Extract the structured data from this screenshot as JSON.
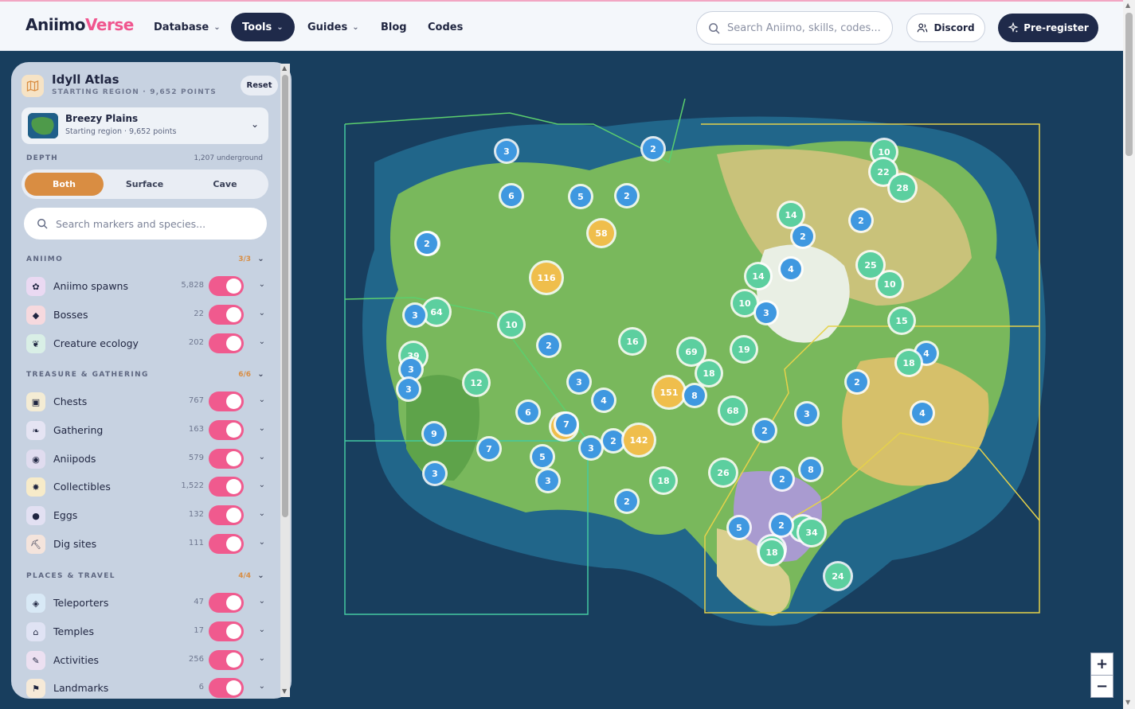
{
  "header": {
    "logo_part1": "Aniimo",
    "logo_part2": "Verse",
    "nav": [
      {
        "label": "Database",
        "has_menu": true
      },
      {
        "label": "Tools",
        "has_menu": true,
        "active": true
      },
      {
        "label": "Guides",
        "has_menu": true
      },
      {
        "label": "Blog",
        "has_menu": false
      },
      {
        "label": "Codes",
        "has_menu": false
      }
    ],
    "search_placeholder": "Search Aniimo, skills, codes...",
    "discord_label": "Discord",
    "preregister_label": "Pre-register"
  },
  "panel": {
    "title": "Idyll Atlas",
    "subtitle": "STARTING REGION · 9,652 POINTS",
    "reset_label": "Reset",
    "region": {
      "name": "Breezy Plains",
      "sub": "Starting region · 9,652 points"
    },
    "depth_label": "DEPTH",
    "depth_count": "1,207 underground",
    "depth_options": [
      "Both",
      "Surface",
      "Cave"
    ],
    "depth_selected": "Both",
    "search_placeholder": "Search markers and species...",
    "sections": [
      {
        "title": "ANIIMO",
        "count": "3/3",
        "items": [
          {
            "label": "Aniimo spawns",
            "count": "5,828",
            "icon": "aniimo-icon",
            "on": true
          },
          {
            "label": "Bosses",
            "count": "22",
            "icon": "boss-icon",
            "on": true
          },
          {
            "label": "Creature ecology",
            "count": "202",
            "icon": "ecology-icon",
            "on": true
          }
        ]
      },
      {
        "title": "TREASURE & GATHERING",
        "count": "6/6",
        "items": [
          {
            "label": "Chests",
            "count": "767",
            "icon": "chest-icon",
            "on": true
          },
          {
            "label": "Gathering",
            "count": "163",
            "icon": "gathering-icon",
            "on": true
          },
          {
            "label": "Aniipods",
            "count": "579",
            "icon": "aniipod-icon",
            "on": true
          },
          {
            "label": "Collectibles",
            "count": "1,522",
            "icon": "collectible-icon",
            "on": true
          },
          {
            "label": "Eggs",
            "count": "132",
            "icon": "egg-icon",
            "on": true
          },
          {
            "label": "Dig sites",
            "count": "111",
            "icon": "dig-site-icon",
            "on": true
          }
        ]
      },
      {
        "title": "PLACES & TRAVEL",
        "count": "4/4",
        "items": [
          {
            "label": "Teleporters",
            "count": "47",
            "icon": "teleporter-icon",
            "on": true
          },
          {
            "label": "Temples",
            "count": "17",
            "icon": "temple-icon",
            "on": true
          },
          {
            "label": "Activities",
            "count": "256",
            "icon": "activity-icon",
            "on": true
          },
          {
            "label": "Landmarks",
            "count": "6",
            "icon": "landmark-icon",
            "on": true
          }
        ]
      }
    ]
  },
  "map": {
    "zoom_in": "+",
    "zoom_out": "−",
    "clusters": [
      "3",
      "2",
      "6",
      "5",
      "2",
      "58",
      "116",
      "10",
      "64",
      "3",
      "39",
      "3",
      "3",
      "16",
      "69",
      "19",
      "18",
      "151",
      "8",
      "68",
      "26",
      "18",
      "2",
      "14",
      "10",
      "3",
      "4",
      "10",
      "2",
      "14",
      "2",
      "25",
      "15",
      "10",
      "22",
      "28",
      "4",
      "18",
      "2",
      "4",
      "20",
      "24",
      "2",
      "3",
      "18",
      "17",
      "5",
      "2",
      "3",
      "2",
      "2",
      "34",
      "8",
      "2",
      "5",
      "3",
      "60",
      "2",
      "142",
      "4",
      "3",
      "3",
      "7",
      "2",
      "12",
      "6",
      "7",
      "9"
    ]
  },
  "colors": {
    "accent_pink": "#f05a8e",
    "accent_orange": "#d98d42",
    "navy": "#1f2a4a",
    "cluster_green": "#5ccf9f",
    "cluster_blue": "#3f98e0",
    "cluster_gold": "#efbe4c"
  }
}
